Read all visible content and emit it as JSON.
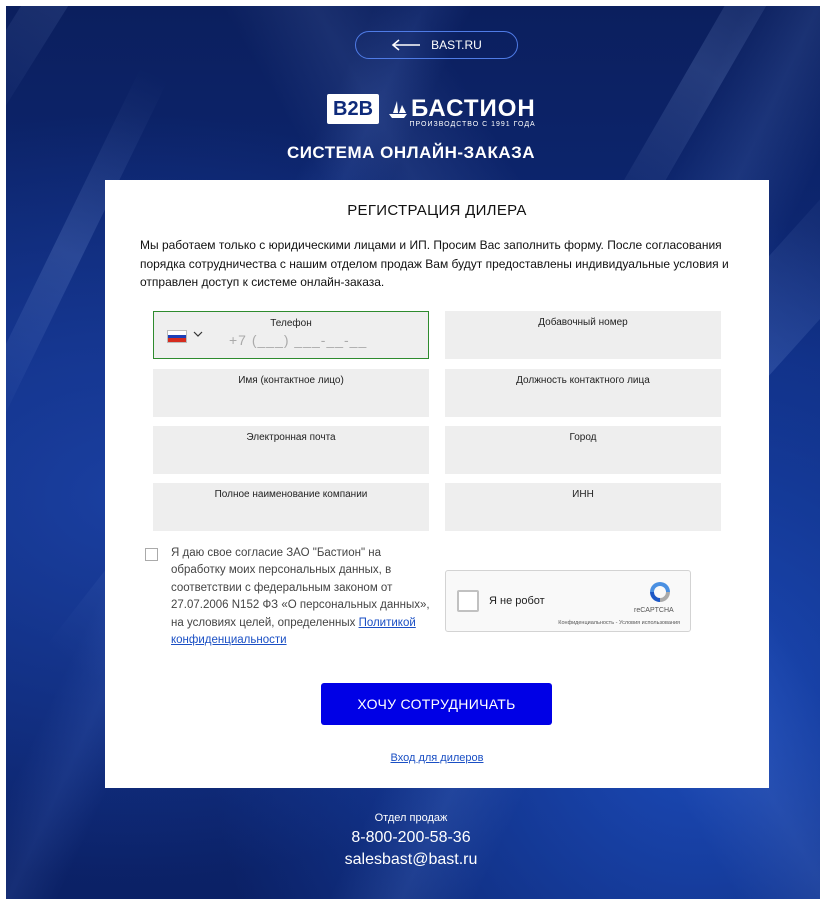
{
  "header": {
    "back_link": "BAST.RU",
    "logo_b2b": "B2B",
    "logo_name": "БАСТИОН",
    "logo_tagline": "ПРОИЗВОДСТВО С 1991 ГОДА",
    "system_title": "СИСТЕМА ОНЛАЙН-ЗАКАЗА"
  },
  "form": {
    "title": "РЕГИСТРАЦИЯ ДИЛЕРА",
    "intro": "Мы работаем только с юридическими лицами и ИП. Просим Вас заполнить форму. После согласования порядка сотрудничества с нашим отделом продаж Вам будут предоставлены индивидуальные условия и отправлен доступ к системе онлайн-заказа.",
    "fields": {
      "phone_label": "Телефон",
      "phone_mask": "+7 (___) ___-__-__",
      "extension_label": "Добавочный номер",
      "name_label": "Имя (контактное лицо)",
      "position_label": "Должность контактного лица",
      "email_label": "Электронная почта",
      "city_label": "Город",
      "company_label": "Полное наименование компании",
      "inn_label": "ИНН"
    },
    "consent_text": "Я даю свое согласие ЗАО \"Бастион\" на обработку моих персональных данных, в соответствии с федеральным законом от 27.07.2006 N152 ФЗ «О персональных данных», на условиях целей, определенных ",
    "consent_link": "Политикой конфиденциальности",
    "captcha": {
      "label": "Я не робот",
      "brand": "reCAPTCHA",
      "legal": "Конфиденциальность - Условия использования"
    },
    "submit_label": "ХОЧУ СОТРУДНИЧАТЬ",
    "dealer_login": "Вход для дилеров"
  },
  "footer": {
    "label": "Отдел продаж",
    "phone": "8-800-200-58-36",
    "email": "salesbast@bast.ru"
  },
  "colors": {
    "accent_button": "#0000e6",
    "link": "#1a4fc4",
    "active_field_border": "#2e8b2e",
    "background_dark_blue": "#0e2a7a"
  }
}
